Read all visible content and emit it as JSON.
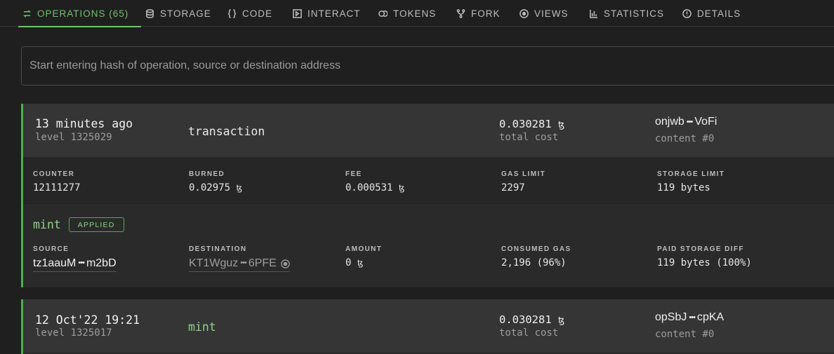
{
  "tabs": [
    {
      "label": "OPERATIONS (65)",
      "icon": "swap-icon"
    },
    {
      "label": "STORAGE",
      "icon": "database-icon"
    },
    {
      "label": "CODE",
      "icon": "braces-icon"
    },
    {
      "label": "INTERACT",
      "icon": "play-square-icon"
    },
    {
      "label": "TOKENS",
      "icon": "coins-icon"
    },
    {
      "label": "FORK",
      "icon": "fork-icon"
    },
    {
      "label": "VIEWS",
      "icon": "eye-circle-icon"
    },
    {
      "label": "STATISTICS",
      "icon": "bar-chart-icon"
    },
    {
      "label": "DETAILS",
      "icon": "info-icon"
    }
  ],
  "search": {
    "placeholder": "Start entering hash of operation, source or destination address"
  },
  "colors": {
    "accent": "#6fc26b",
    "card_border": "#4caf50"
  },
  "operations": [
    {
      "time": "13 minutes ago",
      "level": "level 1325029",
      "kind": "transaction",
      "cost": "0.030281",
      "cost_unit": "ꜩ",
      "cost_label": "total cost",
      "hash_start": "onjwb",
      "hash_end": "VoFi",
      "content": "content #0",
      "params": {
        "counter_label": "COUNTER",
        "counter": "12111277",
        "burned_label": "BURNED",
        "burned": "0.02975",
        "fee_label": "FEE",
        "fee": "0.000531",
        "gas_limit_label": "GAS LIMIT",
        "gas_limit": "2297",
        "storage_limit_label": "STORAGE LIMIT",
        "storage_limit": "119 bytes"
      },
      "entry": {
        "name": "mint",
        "status": "APPLIED",
        "source_label": "SOURCE",
        "source_start": "tz1aauM",
        "source_end": "m2bD",
        "destination_label": "DESTINATION",
        "destination_start": "KT1Wguz",
        "destination_end": "6PFE",
        "amount_label": "AMOUNT",
        "amount": "0",
        "consumed_gas_label": "CONSUMED GAS",
        "consumed_gas": "2,196 (96%)",
        "paid_storage_label": "PAID STORAGE DIFF",
        "paid_storage": "119 bytes (100%)"
      }
    },
    {
      "time": "12 Oct'22 19:21",
      "level": "level 1325017",
      "kind": "mint",
      "cost": "0.030281",
      "cost_unit": "ꜩ",
      "cost_label": "total cost",
      "hash_start": "opSbJ",
      "hash_end": "cpKA",
      "content": "content #0"
    }
  ],
  "ellipsis": "•••"
}
